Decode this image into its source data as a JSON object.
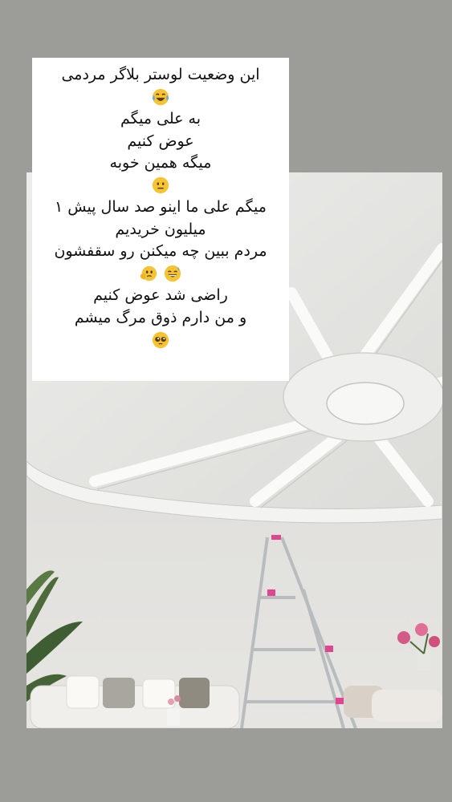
{
  "story": {
    "caption_lines": [
      {
        "text": "این وضعیت لوستر بلاگر مردمی"
      },
      {
        "emoji": [
          "face-with-tears-of-joy-icon"
        ]
      },
      {
        "text": "به علی میگم"
      },
      {
        "text": "عوض کنیم"
      },
      {
        "text": "میگه همین خوبه"
      },
      {
        "emoji": [
          "neutral-face-icon"
        ]
      },
      {
        "text": "میگم علی ما اینو صد سال پیش ۱"
      },
      {
        "text": "میلیون خریدیم"
      },
      {
        "text": "مردم ببین چه میکنن رو سقفشون"
      },
      {
        "emoji": [
          "grinning-face-with-sweat-icon",
          "face-holding-back-tears-icon"
        ]
      },
      {
        "text": "راضی شد عوض کنیم"
      },
      {
        "text": "و من دارم ذوق مرگ میشم"
      },
      {
        "emoji": [
          "pleading-face-icon"
        ]
      }
    ]
  },
  "colors": {
    "background": "#9c9c98",
    "caption_box": "#ffffff",
    "ceiling": "#e7e7e5",
    "ladder_accent": "#e0468f"
  }
}
